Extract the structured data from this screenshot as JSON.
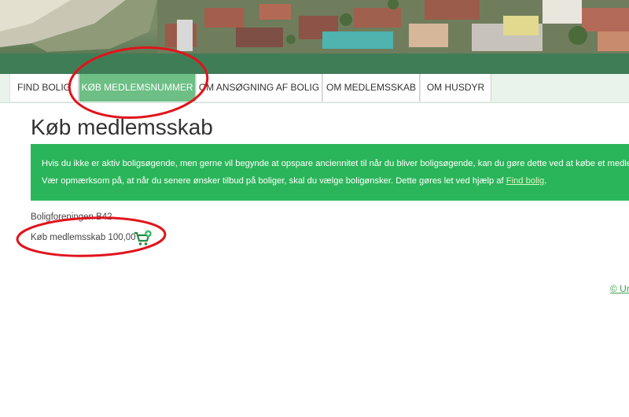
{
  "nav": {
    "items": [
      {
        "label": "FIND BOLIG",
        "active": false
      },
      {
        "label": "KØB MEDLEMSNUMMER",
        "active": true
      },
      {
        "label": "OM ANSØGNING AF BOLIG",
        "active": false
      },
      {
        "label": "OM MEDLEMSSKAB",
        "active": false
      },
      {
        "label": "OM HUSDYR",
        "active": false
      }
    ]
  },
  "main": {
    "title": "Køb medlemsskab",
    "info_line1": "Hvis du ikke er aktiv boligsøgende, men gerne vil begynde at opspare anciennitet til når du bliver boligsøgende, kan du gøre dette ved at købe et medle",
    "info_line2_pre": "Vær opmærksom på, at når du senere ønsker tilbud på boliger, skal du vælge boligønsker. Dette gøres let ved hjælp af ",
    "info_link": "Find bolig",
    "info_line2_post": ".",
    "org_name": "Boligforeningen B42",
    "buy_label": "Køb medlemsskab 100,00"
  },
  "footer": {
    "link": "© Ur"
  },
  "colors": {
    "accent": "#2bb55a",
    "nav_active": "#6dbf85",
    "header_bar": "#3f7d57",
    "annotation": "#e0141c"
  },
  "icons": {
    "cart": "shopping-cart-add-icon"
  }
}
